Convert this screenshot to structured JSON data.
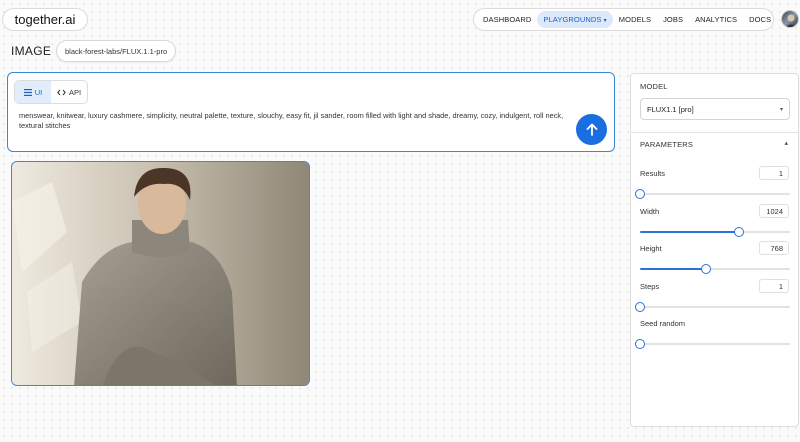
{
  "brand": {
    "logo_text": "together.ai"
  },
  "nav": {
    "items": [
      {
        "label": "DASHBOARD",
        "active": false
      },
      {
        "label": "PLAYGROUNDS",
        "active": true,
        "has_dropdown": true
      },
      {
        "label": "MODELS",
        "active": false
      },
      {
        "label": "JOBS",
        "active": false
      },
      {
        "label": "ANALYTICS",
        "active": false
      },
      {
        "label": "DOCS",
        "active": false
      }
    ],
    "dropdown_icon": "chevron-down-icon"
  },
  "page": {
    "title": "IMAGE",
    "model_chip": "black-forest-labs/FLUX.1.1-pro"
  },
  "prompt": {
    "modes": [
      {
        "label": "UI",
        "icon": "hamburger-icon",
        "active": true
      },
      {
        "label": "API",
        "icon": "code-icon",
        "active": false
      }
    ],
    "text": "menswear, knitwear, luxury cashmere, simplicity, neutral palette, texture, slouchy, easy fit, jil sander, room filled with light and shade, dreamy, cozy, indulgent, roll neck, textural stitches",
    "submit_icon": "arrow-up-icon"
  },
  "result": {
    "image_icon": "generated-image"
  },
  "side_panel": {
    "model_heading": "MODEL",
    "model_selected": "FLUX1.1 [pro]",
    "parameters_heading": "PARAMETERS",
    "parameters": [
      {
        "label": "Results",
        "value": "1",
        "fraction": 0.0
      },
      {
        "label": "Width",
        "value": "1024",
        "fraction": 0.66
      },
      {
        "label": "Height",
        "value": "768",
        "fraction": 0.44
      },
      {
        "label": "Steps",
        "value": "1",
        "fraction": 0.0
      },
      {
        "label": "Seed random",
        "value": "",
        "fraction": 0.0
      }
    ]
  },
  "colors": {
    "accent": "#1a6fe0",
    "nav_active_bg": "#dbe9fb"
  }
}
